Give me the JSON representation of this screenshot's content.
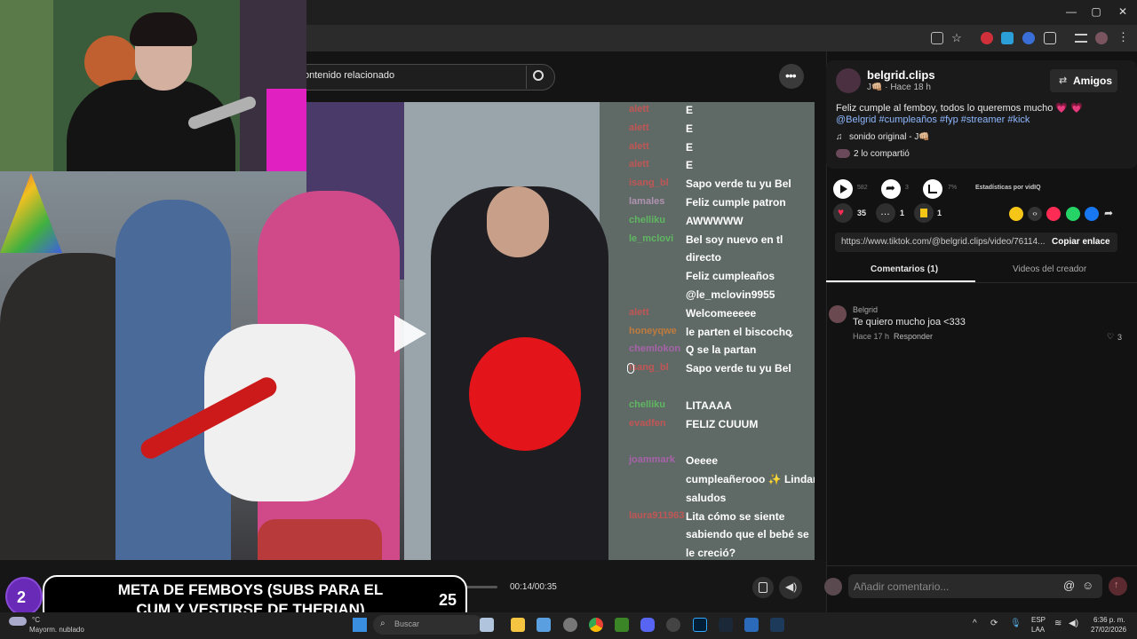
{
  "browser": {
    "window_controls": [
      "—",
      "▢",
      "✕"
    ]
  },
  "video": {
    "search_placeholder": "ontenido relacionado",
    "time": "00:14/00:35",
    "chat": [
      {
        "user": "alett",
        "msg": "E",
        "color": "#e05050"
      },
      {
        "user": "alett",
        "msg": "E",
        "color": "#e05050"
      },
      {
        "user": "alett",
        "msg": "E",
        "color": "#e05050"
      },
      {
        "user": "alett",
        "msg": "E",
        "color": "#e05050"
      },
      {
        "user": "isang_bl",
        "msg": "Sapo verde tu yu Bel",
        "color": "#e05050"
      },
      {
        "user": "lamales",
        "msg": "Feliz cumple patron",
        "color": "#c9a0c9"
      },
      {
        "user": "chelliku",
        "msg": "AWWWWW",
        "color": "#60d060"
      },
      {
        "user": "le_mclovi",
        "msg": "Bel soy nuevo en tl",
        "color": "#60d060"
      },
      {
        "user": "",
        "msg": "directo",
        "color": "#fff"
      },
      {
        "user": "",
        "msg": "Feliz cumpleaños",
        "color": "#fff"
      },
      {
        "user": "",
        "msg": "@le_mclovin9955",
        "color": "#fff"
      },
      {
        "user": "alett",
        "msg": "Welcomeeeee",
        "color": "#e05050"
      },
      {
        "user": "honeyqwe",
        "msg": "le parten el biscocho",
        "color": "#e08030"
      },
      {
        "user": "chemlokon",
        "msg": "Q se la partan",
        "color": "#c060c0"
      },
      {
        "user": "isang_bl",
        "msg": "Sapo verde tu yu Bel",
        "color": "#e05050"
      },
      {
        "user": "",
        "msg": "",
        "color": "#fff"
      },
      {
        "user": "chelliku",
        "msg": "LITAAAA",
        "color": "#60d060"
      },
      {
        "user": "evadfen",
        "msg": "FELIZ CUUUM",
        "color": "#e05050"
      },
      {
        "user": "",
        "msg": "",
        "color": "#fff"
      },
      {
        "user": "joammark",
        "msg": "Oeeee",
        "color": "#c060c0"
      },
      {
        "user": "",
        "msg": "cumpleañerooo ✨ Lindar",
        "color": "#fff"
      },
      {
        "user": "",
        "msg": "saludos",
        "color": "#fff"
      },
      {
        "user": "laura911963",
        "msg": "Lita cómo se siente",
        "color": "#e05050"
      },
      {
        "user": "",
        "msg": "sabiendo que el bebé se",
        "color": "#fff"
      },
      {
        "user": "",
        "msg": "le creció?",
        "color": "#fff"
      }
    ]
  },
  "overlay": {
    "badge": "2",
    "line1": "META DE FEMBOYS (SUBS PARA EL",
    "line2": "CUM Y VESTIRSE DE THERIAN)",
    "count": "25",
    "weather": "Mayorm. nublado",
    "weather_temp": "°C"
  },
  "post": {
    "author": "belgrid.clips",
    "author_sub": "J👊🏼 · Hace 18 h",
    "follow_label": "Amigos",
    "caption": "Feliz cumple al femboy, todos lo queremos mucho 💗 💗",
    "tags": "@Belgrid #cumpleaños #fyp #streamer #kick",
    "sound": "sonido original - J👊🏼",
    "shared": "2 lo compartió",
    "play_count": "582",
    "share_count": "3",
    "stats_pct": "7%",
    "stats_label": "Estadísticas por vidIQ",
    "likes": "35",
    "comments": "1",
    "saves": "1",
    "url": "https://www.tiktok.com/@belgrid.clips/video/76114...",
    "copy_label": "Copiar enlace",
    "tab_comments": "Comentarios (1)",
    "tab_videos": "Videos del creador"
  },
  "comment": {
    "user": "Belgrid",
    "text": "Te quiero mucho joa <333",
    "time": "Hace 17 h",
    "reply": "Responder",
    "likes": "3"
  },
  "comment_box": {
    "placeholder": "Añadir comentario..."
  },
  "taskbar": {
    "search": "Buscar",
    "lang": "ESP",
    "lang2": "LAA",
    "time": "6:36 p. m.",
    "date": "27/02/2026"
  },
  "colors": {
    "accent": "#fe2c55",
    "link": "#8fb8ff"
  }
}
